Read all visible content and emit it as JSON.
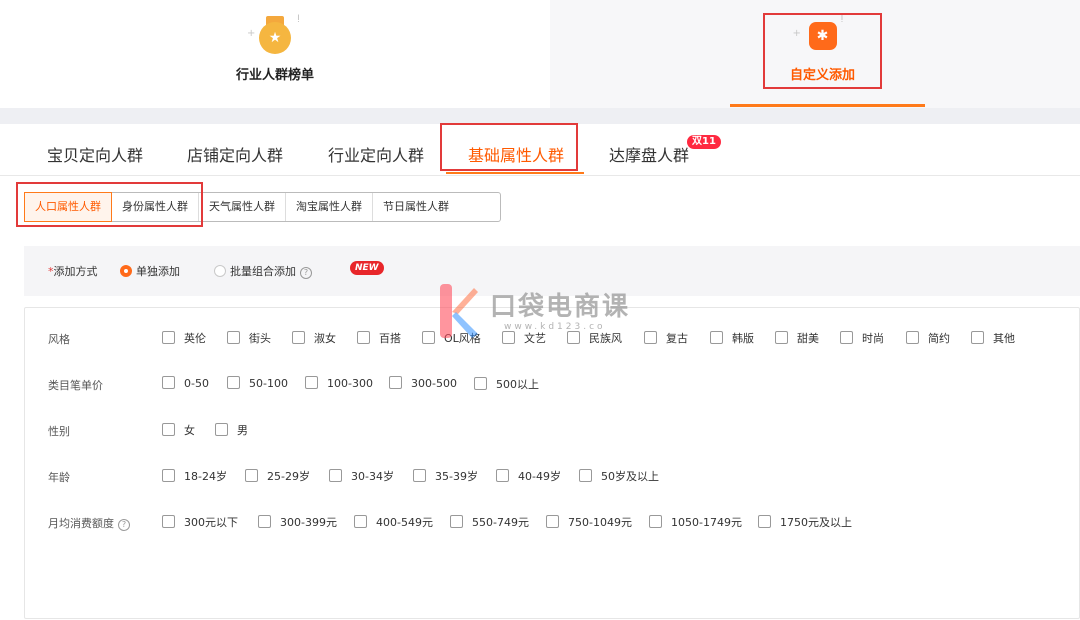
{
  "header": {
    "tabs": [
      {
        "label": "行业人群榜单",
        "active": false
      },
      {
        "label": "自定义添加",
        "active": true
      }
    ]
  },
  "tabs": [
    {
      "label": "宝贝定向人群"
    },
    {
      "label": "店铺定向人群"
    },
    {
      "label": "行业定向人群"
    },
    {
      "label": "基础属性人群",
      "active": true
    },
    {
      "label": "达摩盘人群",
      "badge": "双11"
    }
  ],
  "subtabs": [
    {
      "label": "人口属性人群",
      "active": true
    },
    {
      "label": "身份属性人群"
    },
    {
      "label": "天气属性人群"
    },
    {
      "label": "淘宝属性人群"
    },
    {
      "label": "节日属性人群"
    }
  ],
  "add_method": {
    "required_mark": "*",
    "label": "添加方式",
    "options": [
      {
        "label": "单独添加",
        "selected": true
      },
      {
        "label": "批量组合添加",
        "selected": false
      }
    ],
    "new_badge": "NEW"
  },
  "attributes": [
    {
      "label": "风格",
      "options": [
        "英伦",
        "街头",
        "淑女",
        "百搭",
        "OL风格",
        "文艺",
        "民族风",
        "复古",
        "韩版",
        "甜美",
        "时尚",
        "简约",
        "其他"
      ]
    },
    {
      "label": "类目笔单价",
      "options": [
        "0-50",
        "50-100",
        "100-300",
        "300-500",
        "500以上"
      ]
    },
    {
      "label": "性别",
      "options": [
        "女",
        "男"
      ]
    },
    {
      "label": "年龄",
      "options": [
        "18-24岁",
        "25-29岁",
        "30-34岁",
        "35-39岁",
        "40-49岁",
        "50岁及以上"
      ]
    },
    {
      "label": "月均消费额度",
      "options": [
        "300元以下",
        "300-399元",
        "400-549元",
        "550-749元",
        "750-1049元",
        "1050-1749元",
        "1750元及以上"
      ]
    }
  ],
  "watermark": {
    "text": "口袋电商课",
    "url": "www.kd123.co"
  },
  "colors": {
    "accent": "#ff5a00",
    "annotation": "#e23a3a",
    "badge": "#ff2940"
  }
}
